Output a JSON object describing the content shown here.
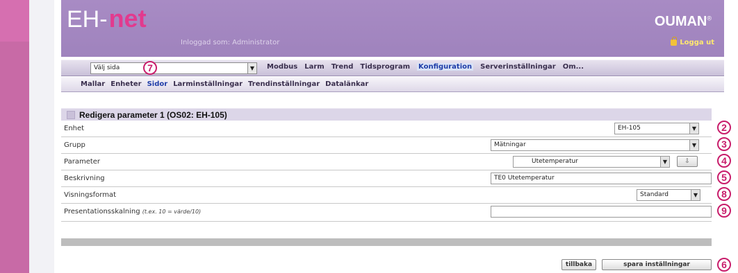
{
  "header": {
    "logo_eh": "EH-",
    "logo_net": "net",
    "logged_in": "Inloggad som: Administrator",
    "brand": "OUMAN",
    "brand_mark": "®",
    "logout": "Logga ut",
    "logout_icon": "lock-icon"
  },
  "menubar": {
    "page_select_value": "Välj sida",
    "items": [
      "Modbus",
      "Larm",
      "Trend",
      "Tidsprogram",
      "Konfiguration",
      "Serverinställningar",
      "Om..."
    ],
    "active_item": "Konfiguration"
  },
  "submenu": {
    "items": [
      "Mallar",
      "Enheter",
      "Sidor",
      "Larminställningar",
      "Trendinställningar",
      "Datalänkar"
    ],
    "active_item": "Sidor"
  },
  "panel": {
    "title": "Redigera parameter 1 (OS02: EH-105)"
  },
  "form": {
    "enhet": {
      "label": "Enhet",
      "value": "EH-105"
    },
    "grupp": {
      "label": "Grupp",
      "value": "Mätningar"
    },
    "parameter": {
      "label": "Parameter",
      "value": "Utetemperatur",
      "button_icon": "download-icon"
    },
    "beskrivning": {
      "label": "Beskrivning",
      "value": "TE0 Utetemperatur"
    },
    "visningsformat": {
      "label": "Visningsformat",
      "value": "Standard"
    },
    "presentationsskalning": {
      "label": "Presentationsskalning",
      "hint": "(t.ex. 10 = värde/10)",
      "value": ""
    }
  },
  "buttons": {
    "back": "tillbaka",
    "save": "spara inställningar"
  },
  "callouts": {
    "c7": "7",
    "c2": "2",
    "c3": "3",
    "c4": "4",
    "c5": "5",
    "c8": "8",
    "c9": "9",
    "c6": "6"
  },
  "colors": {
    "header_purple": "#a88bc4",
    "accent_pink": "#e23a8e",
    "callout": "#c81d6b",
    "active_menu": "#1f3da8"
  }
}
